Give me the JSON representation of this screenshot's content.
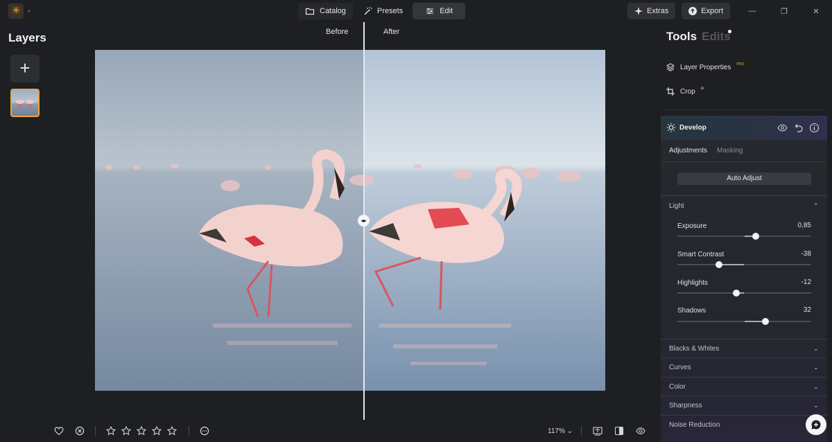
{
  "topbar": {
    "tabs": [
      {
        "label": "Catalog",
        "icon": "folder-icon"
      },
      {
        "label": "Presets",
        "icon": "magic-wand-icon"
      },
      {
        "label": "Edit",
        "icon": "sliders-icon",
        "active": true
      }
    ],
    "extras_label": "Extras",
    "export_label": "Export"
  },
  "layers": {
    "title": "Layers",
    "add_symbol": "+"
  },
  "compare": {
    "before_label": "Before",
    "after_label": "After"
  },
  "bottom_bar": {
    "zoom": "117%",
    "rating_stars": 5,
    "rating_value": 0
  },
  "right_panel": {
    "tools_title": "Tools",
    "edits_title": "Edits",
    "layer_properties_label": "Layer Properties",
    "layer_properties_badge": "PRO",
    "crop_label": "Crop",
    "crop_badge": "AI",
    "develop": {
      "title": "Develop",
      "tabs": [
        "Adjustments",
        "Masking"
      ],
      "auto_adjust_label": "Auto Adjust",
      "light": {
        "title": "Light",
        "sliders": [
          {
            "label": "Exposure",
            "value": "0,85",
            "min": -5,
            "max": 5,
            "num": 0.85
          },
          {
            "label": "Smart Contrast",
            "value": "-38",
            "min": -100,
            "max": 100,
            "num": -38
          },
          {
            "label": "Highlights",
            "value": "-12",
            "min": -100,
            "max": 100,
            "num": -12
          },
          {
            "label": "Shadows",
            "value": "32",
            "min": -100,
            "max": 100,
            "num": 32
          }
        ]
      },
      "sections": [
        "Blacks & Whites",
        "Curves",
        "Color",
        "Sharpness",
        "Noise Reduction"
      ]
    }
  },
  "colors": {
    "accent": "#f0a43a",
    "panel_bg": "#1e1f22",
    "develop_gradient_start": "#25363f",
    "develop_gradient_end": "#313050"
  }
}
